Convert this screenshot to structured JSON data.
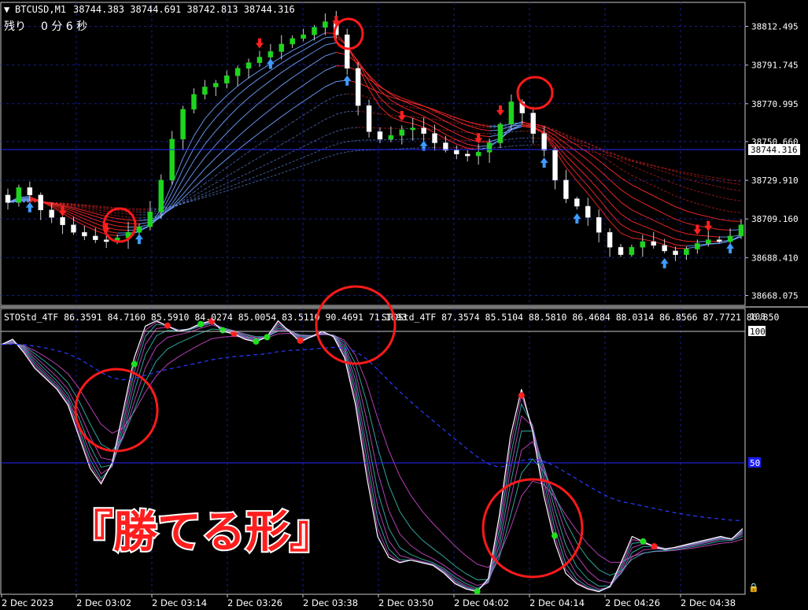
{
  "header": {
    "menu_glyph": "▼",
    "symbol": "BTCUSD,M1",
    "ohlc": "38744.383 38744.691 38742.813 38744.316",
    "countdown_label": "残り",
    "countdown_value": "0 分 6 秒"
  },
  "price_axis": {
    "labels": [
      "38812.495",
      "38791.745",
      "38770.995",
      "38750.660",
      "38729.910",
      "38709.160",
      "38688.410",
      "38668.075"
    ],
    "current_price": "38744.316"
  },
  "indicator": {
    "title": "STOStd_4TF 86.3591 84.7160 85.5910 84.0274 85.0054 83.5110 90.4691 71.1693",
    "title2": "STOStd_4TF 87.3574 85.5104 88.5810 86.4684 88.0314 86.8566 87.7721 86.850",
    "axis_top": "108",
    "axis_100": "100",
    "axis_mid": "50"
  },
  "time_axis": {
    "labels": [
      "2 Dec 2023",
      "2 Dec 03:02",
      "2 Dec 03:14",
      "2 Dec 03:26",
      "2 Dec 03:38",
      "2 Dec 03:50",
      "2 Dec 04:02",
      "2 Dec 04:14",
      "2 Dec 04:26",
      "2 Dec 04:38"
    ]
  },
  "overlay": {
    "caption": "『勝てる形』"
  },
  "colors": {
    "bull": "#1fd41f",
    "bear": "#ffffff",
    "grid": "#16208a",
    "current_line": "#2a2aff",
    "up_ribbon": "#6fa0ff",
    "down_ribbon": "#ff2a2a",
    "highlight": "#ff1a1a",
    "stoch_main": "#ffffff",
    "stoch_magenta": "#d64bd6",
    "stoch_teal": "#35c3b6"
  },
  "chart_data": [
    {
      "type": "candlestick",
      "title": "BTCUSD,M1",
      "ylim": [
        38660,
        38818
      ],
      "y_ticks": [
        38812.495,
        38791.745,
        38770.995,
        38750.66,
        38729.91,
        38709.16,
        38688.41,
        38668.075
      ],
      "x_tick_labels": [
        "2 Dec 2023",
        "2 Dec 03:02",
        "2 Dec 03:14",
        "2 Dec 03:26",
        "2 Dec 03:38",
        "2 Dec 03:50",
        "2 Dec 04:02",
        "2 Dec 04:14",
        "2 Dec 04:26",
        "2 Dec 04:38"
      ],
      "current_price": 38744.316,
      "close_path": [
        38718,
        38726,
        38722,
        38714,
        38710,
        38706,
        38702,
        38700,
        38698,
        38697,
        38699,
        38702,
        38705,
        38713,
        38730,
        38752,
        38768,
        38776,
        38780,
        38782,
        38786,
        38790,
        38793,
        38796,
        38799,
        38803,
        38806,
        38808,
        38812,
        38815,
        38808,
        38790,
        38770,
        38756,
        38752,
        38754,
        38757,
        38758,
        38755,
        38750,
        38746,
        38744,
        38743,
        38745,
        38750,
        38760,
        38772,
        38766,
        38755,
        38746,
        38730,
        38720,
        38716,
        38710,
        38702,
        38694,
        38690,
        38694,
        38697,
        38695,
        38692,
        38690,
        38693,
        38696,
        38698,
        38697,
        38700,
        38706
      ],
      "up_arrows": [
        2,
        12,
        24,
        31,
        38,
        49,
        52,
        60,
        66
      ],
      "down_arrows": [
        5,
        9,
        23,
        30,
        36,
        43,
        45,
        63,
        64
      ]
    },
    {
      "type": "line",
      "title": "STOStd_4TF",
      "ylim": [
        0,
        108
      ],
      "y_ticks": [
        100,
        50
      ],
      "series_count": 8,
      "main_path": [
        95,
        97,
        92,
        86,
        82,
        78,
        72,
        60,
        48,
        42,
        50,
        70,
        90,
        102,
        104,
        102,
        100,
        101,
        103,
        104,
        100,
        99,
        97,
        96,
        98,
        104,
        100,
        96,
        98,
        100,
        98,
        90,
        72,
        45,
        22,
        14,
        12,
        13,
        12,
        11,
        8,
        4,
        2,
        1,
        6,
        30,
        60,
        78,
        62,
        38,
        20,
        8,
        4,
        2,
        1,
        3,
        12,
        22,
        20,
        18,
        17,
        18,
        19,
        20,
        21,
        22,
        21,
        25
      ],
      "green_dots": [
        12,
        18,
        20,
        23,
        24,
        43,
        50,
        58
      ],
      "red_dots": [
        15,
        19,
        21,
        27,
        47,
        59
      ]
    }
  ]
}
